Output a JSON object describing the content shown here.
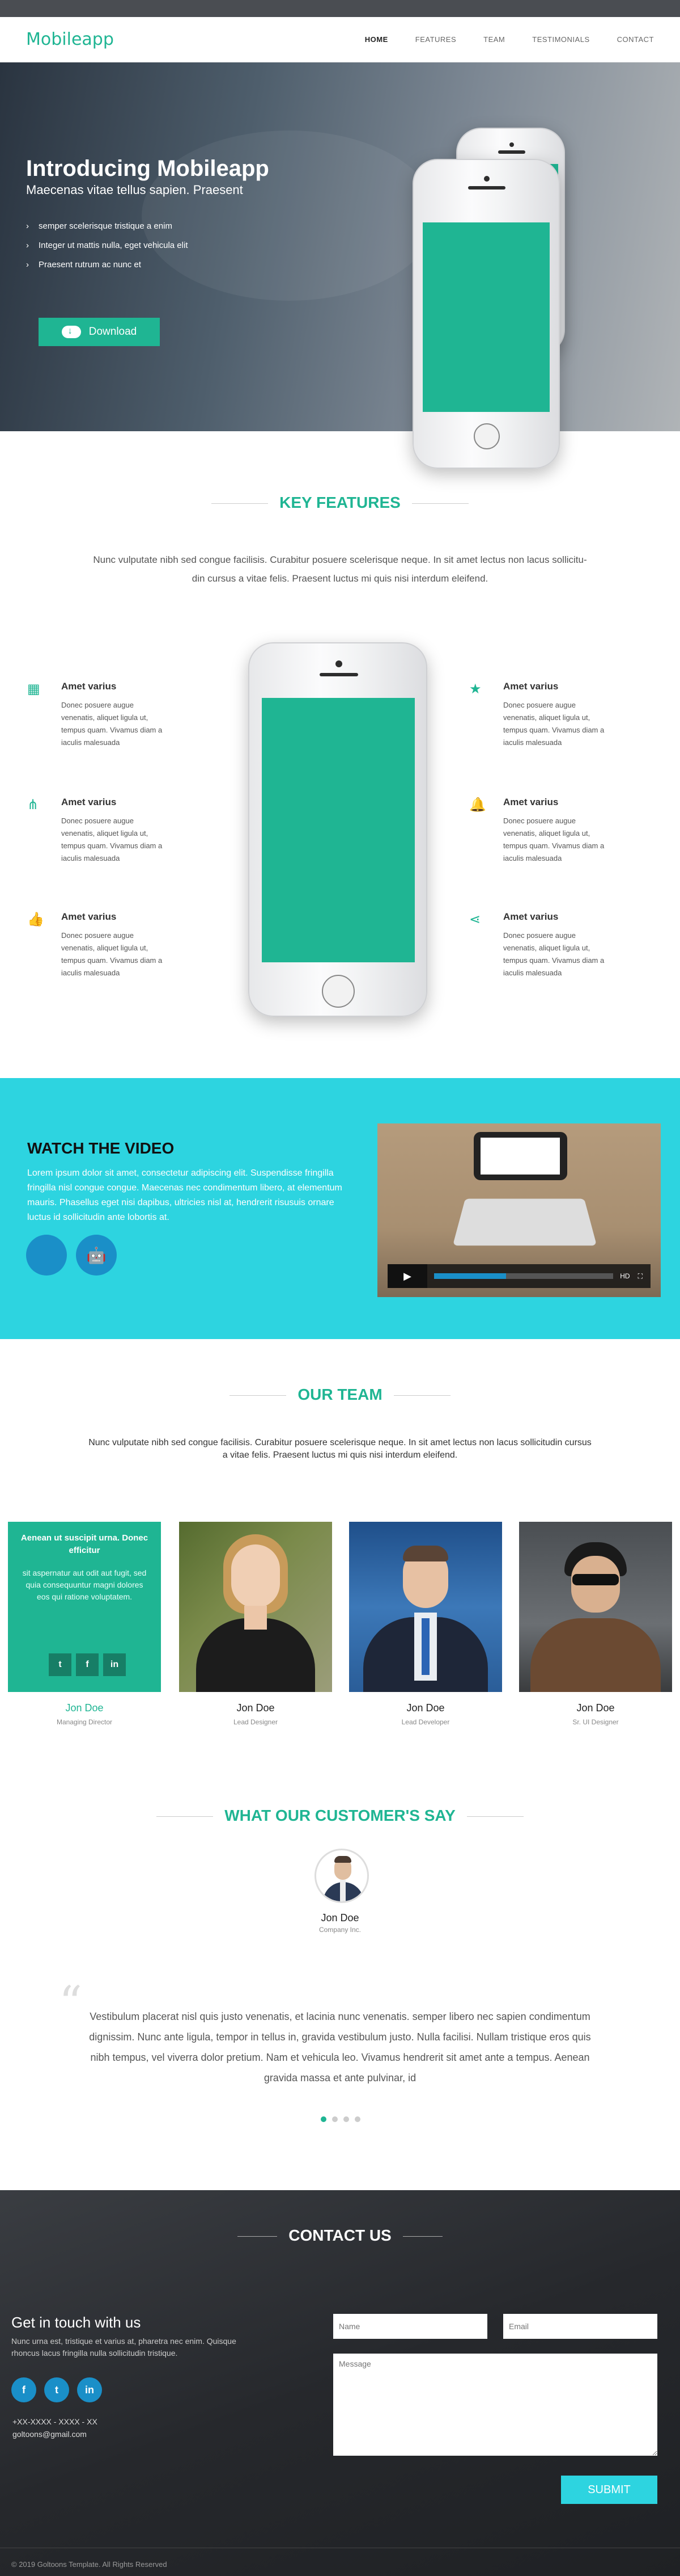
{
  "nav": {
    "logo": "Mobileapp",
    "items": [
      {
        "label": "HOME",
        "active": true
      },
      {
        "label": "FEATURES",
        "active": false
      },
      {
        "label": "TEAM",
        "active": false
      },
      {
        "label": "TESTIMONIALS",
        "active": false
      },
      {
        "label": "CONTACT",
        "active": false
      }
    ]
  },
  "hero": {
    "title": "Introducing Mobileapp",
    "subtitle": "Maecenas vitae tellus sapien. Praesent",
    "bullets": [
      "semper scelerisque tristique a enim",
      "Integer ut mattis nulla, eget vehicula elit",
      "Praesent rutrum ac nunc et"
    ],
    "download_label": "Download"
  },
  "features": {
    "title": "KEY FEATURES",
    "intro_line1": "Nunc vulputate nibh sed congue facilisis. Curabitur posuere scelerisque neque. In sit amet lectus non lacus sollicitu-",
    "intro_line2": "din cursus a vitae felis. Praesent luctus mi quis nisi interdum eleifend.",
    "items": [
      {
        "title": "Amet varius",
        "icon": "grid-icon",
        "text": "Donec posuere augue venenatis, aliquet ligula ut, tempus quam. Vivamus diam a iaculis malesuada"
      },
      {
        "title": "Amet varius",
        "icon": "sitemap-icon",
        "text": "Donec posuere augue venenatis, aliquet ligula ut, tempus quam. Vivamus diam a iaculis malesuada"
      },
      {
        "title": "Amet varius",
        "icon": "thumbs-up-icon",
        "text": "Donec posuere augue venenatis, aliquet ligula ut, tempus quam. Vivamus diam a iaculis malesuada"
      },
      {
        "title": "Amet varius",
        "icon": "star-icon",
        "text": "Donec posuere augue venenatis, aliquet ligula ut, tempus quam. Vivamus diam a iaculis malesuada"
      },
      {
        "title": "Amet varius",
        "icon": "bell-icon",
        "text": "Donec posuere augue venenatis, aliquet ligula ut, tempus quam. Vivamus diam a iaculis malesuada"
      },
      {
        "title": "Amet varius",
        "icon": "share-icon",
        "text": "Donec posuere augue venenatis, aliquet ligula ut, tempus quam. Vivamus diam a iaculis malesuada"
      }
    ]
  },
  "video": {
    "title": "WATCH THE VIDEO",
    "text": "Lorem ipsum dolor sit amet, consectetur adipiscing elit. Suspendisse fringilla fringilla nisl congue congue. Maecenas nec condimentum libero, at elementum mauris. Phasellus eget nisi dapibus, ultricies nisl at, hendrerit risusuis ornare luctus id sollicitudin ante lobortis at.",
    "apple_icon": "apple-icon",
    "android_icon": "android-icon",
    "hd_label": "HD"
  },
  "team": {
    "title": "OUR TEAM",
    "intro_line1": "Nunc vulputate nibh sed congue facilisis. Curabitur posuere scelerisque neque. In sit amet lectus non lacus sollicitudin cursus",
    "intro_line2": "a vitae felis. Praesent luctus mi quis nisi interdum eleifend.",
    "members": [
      {
        "name": "Jon Doe",
        "role": "Managing Director"
      },
      {
        "name": "Jon Doe",
        "role": "Lead Designer"
      },
      {
        "name": "Jon Doe",
        "role": "Lead Developer"
      },
      {
        "name": "Jon Doe",
        "role": "Sr. UI Designer"
      }
    ],
    "overlay_title": "Aenean ut suscipit urna. Donec efficitur",
    "overlay_text": "sit aspernatur aut odit aut fugit, sed quia consequuntur magni dolores eos qui ratione voluptatem."
  },
  "testimonials": {
    "title": "WHAT OUR CUSTOMER'S SAY",
    "name": "Jon Doe",
    "company": "Company Inc.",
    "quote_line1": "Vestibulum placerat nisl quis justo venenatis, et lacinia nunc venenatis. semper libero nec sapien condimentum",
    "quote_line2": "dignissim. Nunc ante ligula, tempor in tellus in, gravida vestibulum justo. Nulla facilisi. Nullam tristique eros quis",
    "quote_line3": "nibh tempus, vel viverra dolor pretium. Nam et vehicula leo. Vivamus hendrerit sit amet ante a tempus. Aenean",
    "quote_line4": "gravida massa et ante pulvinar, id",
    "active_dot": 0,
    "dot_count": 4
  },
  "contact": {
    "title": "CONTACT US",
    "heading": "Get in touch with us",
    "text": "Nunc urna est, tristique et varius at, pharetra nec enim. Quisque rhoncus lacus fringilla nulla sollicitudin tristique.",
    "phone": "+XX-XXXX - XXXX - XX",
    "email": "goltoons@gmail.com",
    "name_placeholder": "Name",
    "email_placeholder": "Email",
    "message_placeholder": "Message",
    "submit_label": "SUBMIT"
  },
  "footer": {
    "copyright": "© 2019 Goltoons Template. All Rights Reserved"
  },
  "colors": {
    "accent": "#1fb593",
    "cyan": "#2dd4e0",
    "blue": "#1a8fc8"
  }
}
